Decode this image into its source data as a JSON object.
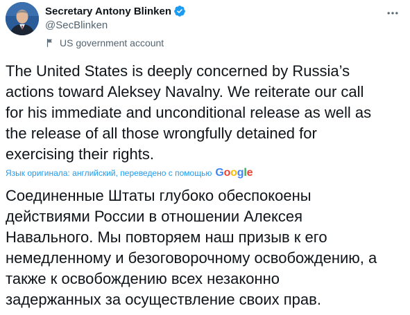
{
  "author": {
    "display_name": "Secretary Antony Blinken",
    "handle": "@SecBlinken",
    "account_label": "US government account"
  },
  "tweet": {
    "lines": [
      "The United States is deeply concerned by Russia’s",
      "actions toward Aleksey Navalny. We reiterate our call",
      "for his immediate and unconditional release as well as",
      "the release of all those wrongfully detained for",
      "exercising their rights."
    ]
  },
  "translation": {
    "note": "Язык оригинала: английский, переведено с помощью",
    "provider": "Google",
    "lines": [
      "Соединенные Штаты глубоко обеспокоены",
      "действиями России в отношении Алексея",
      "Навального. Мы повторяем наш призыв к его",
      "немедленному и безоговорочному освобождению, а",
      "также к освобождению всех незаконно",
      "задержанных за осуществление своих прав."
    ]
  },
  "colors": {
    "text_primary": "#0f1419",
    "text_secondary": "#536471",
    "accent": "#1d9bf0"
  },
  "icons": {
    "verified": "verified-badge-icon",
    "label": "flag-icon",
    "more": "more-options-icon"
  }
}
